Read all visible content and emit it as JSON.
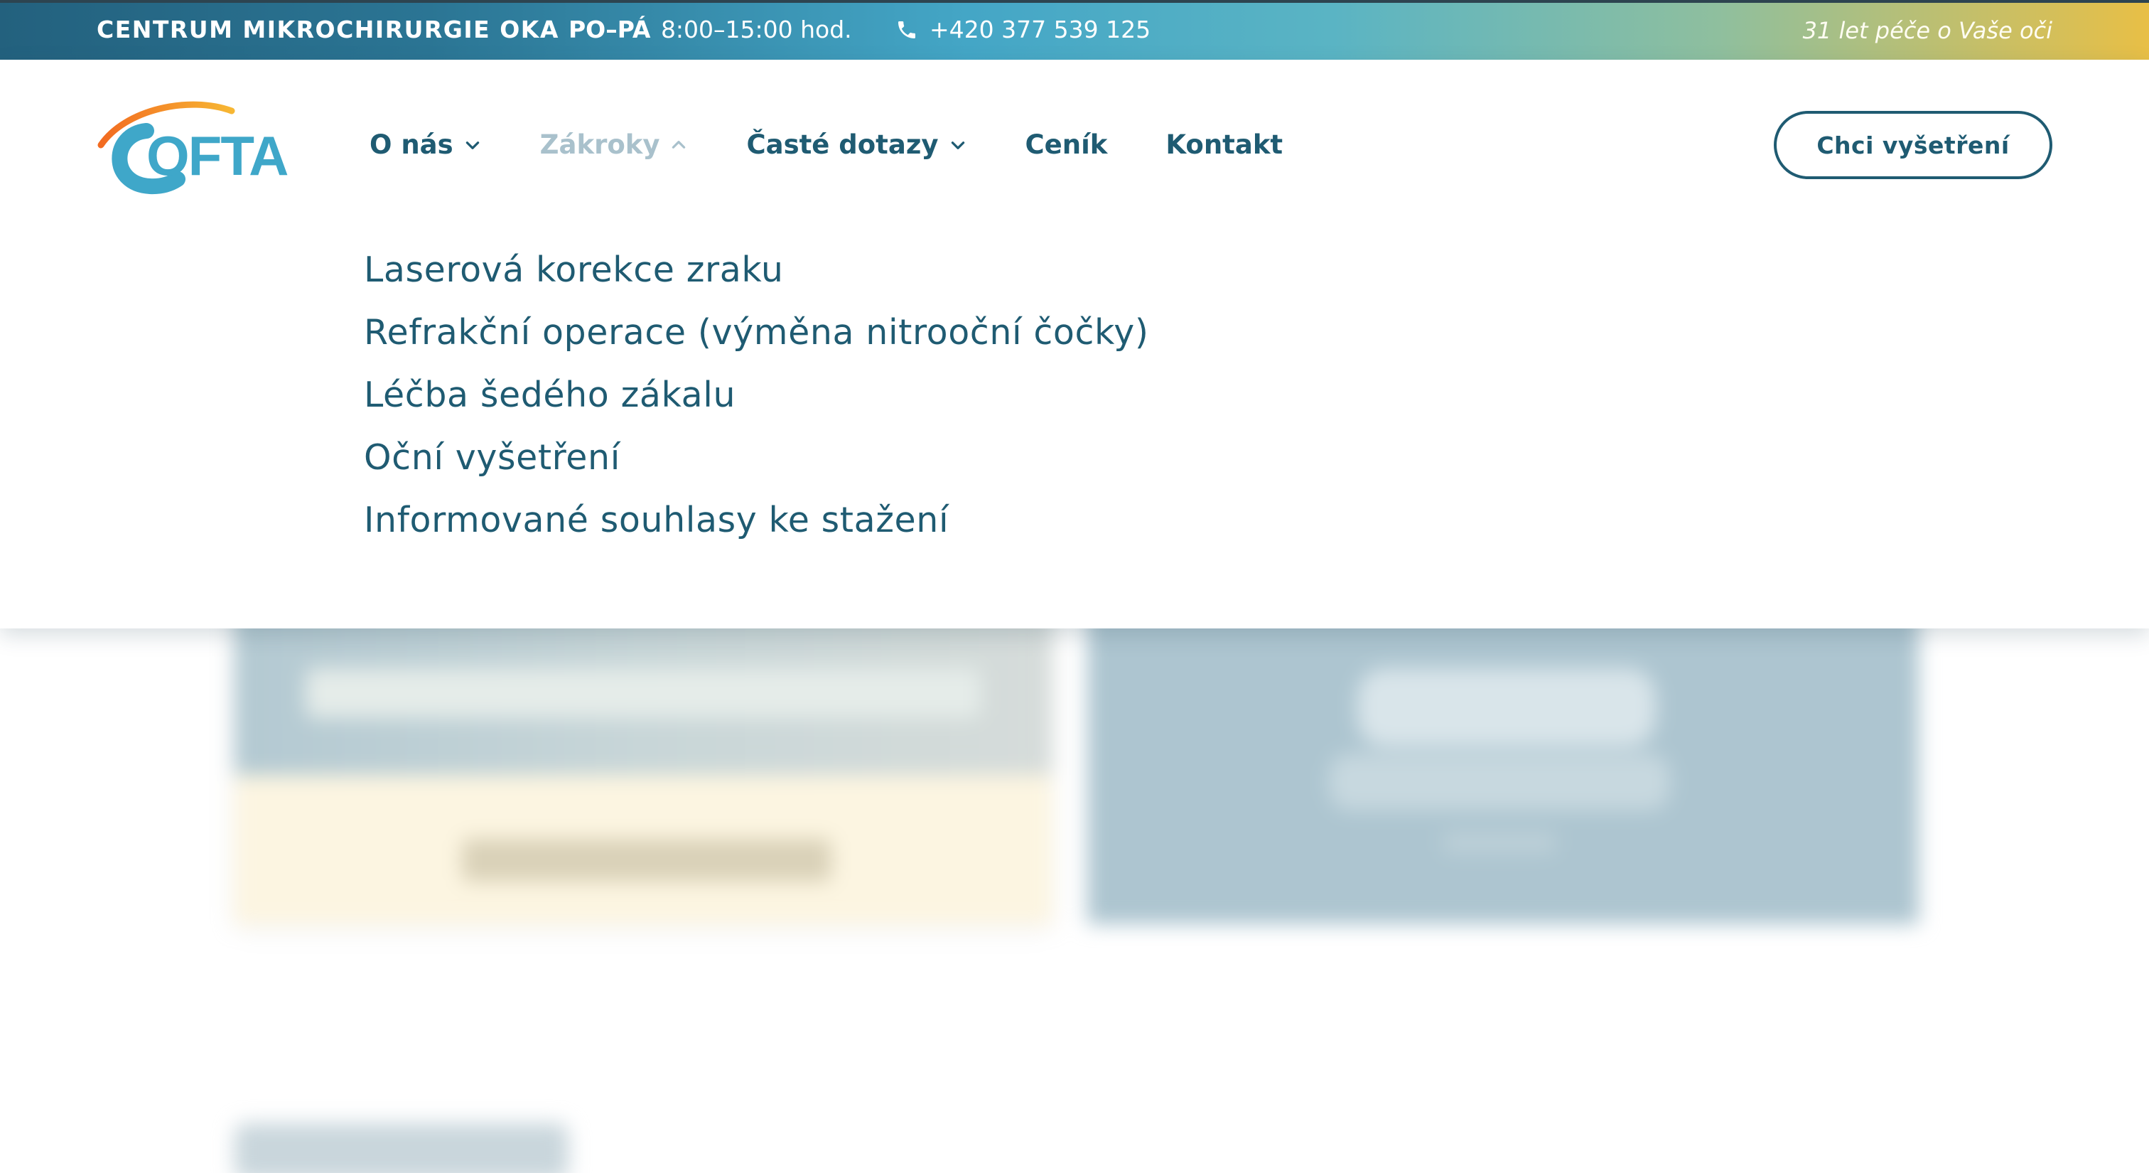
{
  "topbar": {
    "brand": "CENTRUM MIKROCHIRURGIE OKA",
    "hours_days": "PO–PÁ",
    "hours_time": "8:00–15:00 hod.",
    "phone": "+420 377 539 125",
    "tagline": "31 let péče o Vaše oči",
    "gradient_colors": [
      "#23617e",
      "#44a6c6",
      "#8fbf9e",
      "#e8bf46"
    ]
  },
  "header": {
    "logo_text": "OFTA",
    "nav": [
      {
        "label": "O nás",
        "icon": "chevron-down-icon"
      },
      {
        "label": "Zákroky",
        "icon": "chevron-up-icon",
        "active": true
      },
      {
        "label": "Časté dotazy",
        "icon": "chevron-down-icon"
      },
      {
        "label": "Ceník"
      },
      {
        "label": "Kontakt"
      }
    ],
    "cta_label": "Chci vyšetření"
  },
  "submenu": {
    "items": [
      "Laserová korekce zraku",
      "Refrakční operace (výměna nitrooční čočky)",
      "Léčba šedého zákalu",
      "Oční vyšetření",
      "Informované souhlasy ke stažení"
    ]
  },
  "colors": {
    "primary": "#1f5b72",
    "nav_active": "#a9c1cc",
    "logo_blue": "#3fa7c9",
    "logo_orange": "#f08a24"
  }
}
